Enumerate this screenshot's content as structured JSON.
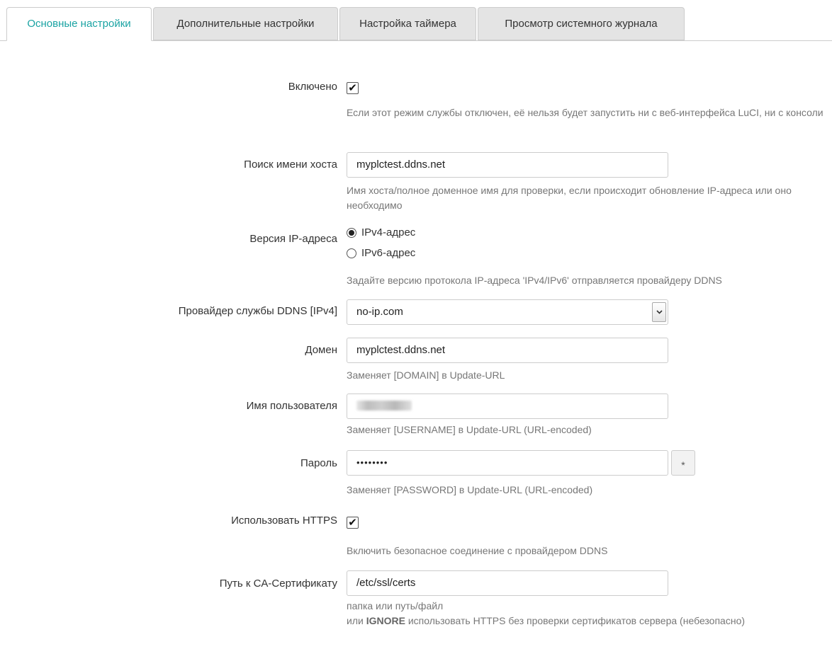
{
  "tabs": [
    {
      "label": "Основные настройки",
      "active": true
    },
    {
      "label": "Дополнительные настройки",
      "active": false
    },
    {
      "label": "Настройка таймера",
      "active": false
    },
    {
      "label": "Просмотр системного журнала",
      "active": false
    }
  ],
  "form": {
    "enabled": {
      "label": "Включено",
      "checked": true,
      "check_glyph": "✔",
      "description": "Если этот режим службы отключен, её нельзя будет запустить ни с веб-интерфейса LuCI, ни с консоли"
    },
    "hostname_lookup": {
      "label": "Поиск имени хоста",
      "value": "myplctest.ddns.net",
      "description": "Имя хоста/полное доменное имя для проверки, если происходит обновление IP-адреса или оно необходимо"
    },
    "ip_version": {
      "label": "Версия IP-адреса",
      "options": [
        {
          "label": "IPv4-адрес",
          "checked": true
        },
        {
          "label": "IPv6-адрес",
          "checked": false
        }
      ],
      "description": "Задайте версию протокола IP-адреса 'IPv4/IPv6' отправляется провайдеру DDNS"
    },
    "ddns_provider": {
      "label": "Провайдер службы DDNS [IPv4]",
      "value": "no-ip.com",
      "arrow_icon": "chevron-down-icon"
    },
    "domain": {
      "label": "Домен",
      "value": "myplctest.ddns.net",
      "description": "Заменяет [DOMAIN] в Update-URL"
    },
    "username": {
      "label": "Имя пользователя",
      "value_obscured": true,
      "description": "Заменяет [USERNAME] в Update-URL (URL-encoded)"
    },
    "password": {
      "label": "Пароль",
      "value": "••••••••",
      "reveal_label": "*",
      "description": "Заменяет [PASSWORD] в Update-URL (URL-encoded)"
    },
    "use_https": {
      "label": "Использовать HTTPS",
      "checked": true,
      "check_glyph": "✔",
      "description": "Включить безопасное соединение с провайдером DDNS"
    },
    "ca_cert_path": {
      "label": "Путь к CA-Сертификату",
      "value": "/etc/ssl/certs",
      "description_line1": "папка или путь/файл",
      "description_line2_prefix": "или",
      "description_line2_keyword": "IGNORE",
      "description_line2_suffix": "использовать HTTPS без проверки сертификатов сервера (небезопасно)"
    }
  },
  "colors": {
    "active_tab_text": "#1aa3a3",
    "inactive_tab_bg": "#e4e4e4",
    "description_text": "#777777",
    "border": "#cccccc"
  }
}
